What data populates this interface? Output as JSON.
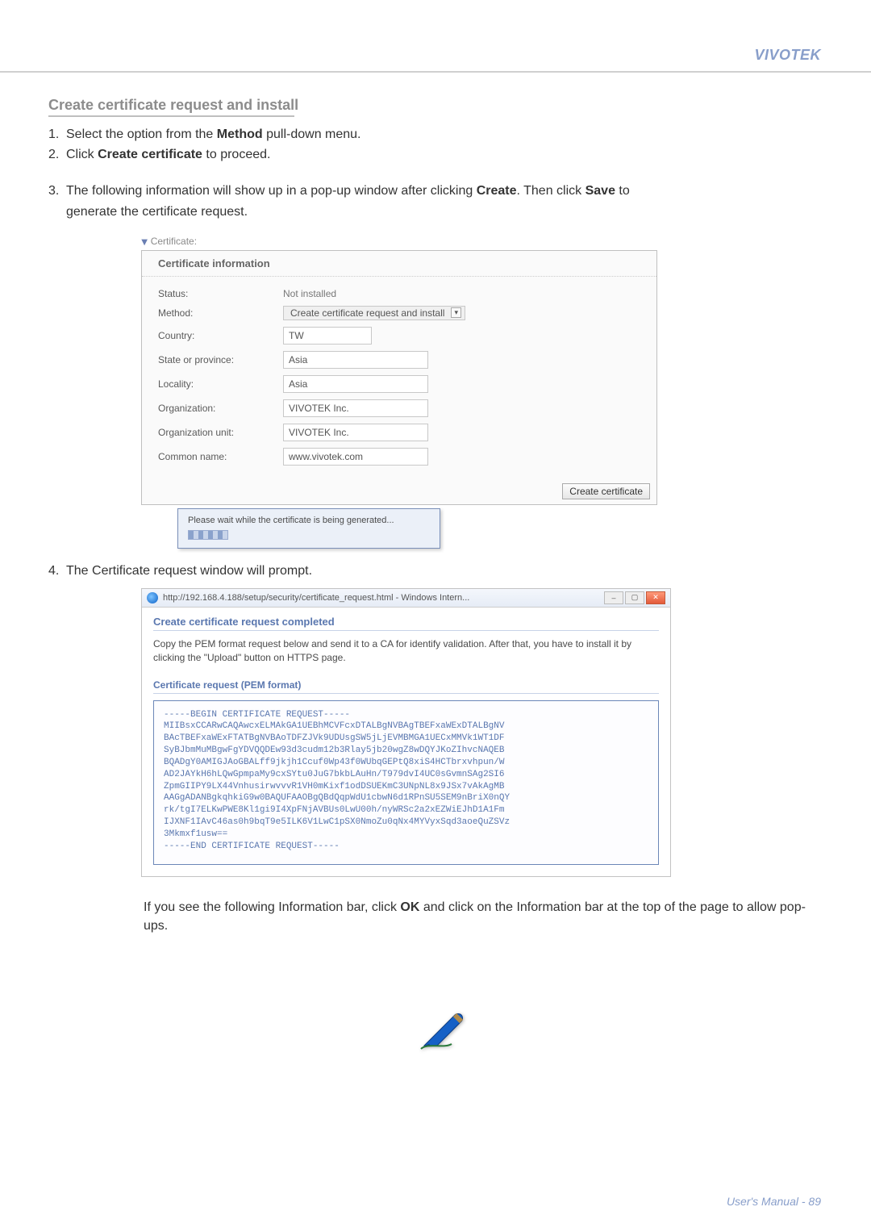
{
  "brand": "VIVOTEK",
  "section_title": "Create certificate request and install",
  "steps": {
    "s1": "Select the option from the ",
    "s1_bold": "Method",
    "s1_tail": " pull-down menu.",
    "s2_pre": "Click ",
    "s2_bold": "Create certificate",
    "s2_tail": " to proceed.",
    "s3_pre": "The following information will show up in a pop-up window after clicking ",
    "s3_bold": "Create",
    "s3_mid": ". Then click ",
    "s3_bold2": "Save",
    "s3_tail": " to ",
    "s3_line2": "generate the certificate request.",
    "s4": "The Certificate request window will prompt."
  },
  "cert": {
    "expand_label": "Certificate:",
    "header": "Certificate information",
    "rows": {
      "status_label": "Status:",
      "status_value": "Not installed",
      "method_label": "Method:",
      "method_value": "Create certificate request and install",
      "country_label": "Country:",
      "country_value": "TW",
      "state_label": "State or province:",
      "state_value": "Asia",
      "locality_label": "Locality:",
      "locality_value": "Asia",
      "org_label": "Organization:",
      "org_value": "VIVOTEK Inc.",
      "ou_label": "Organization unit:",
      "ou_value": "VIVOTEK Inc.",
      "cn_label": "Common name:",
      "cn_value": "www.vivotek.com"
    },
    "create_btn": "Create certificate"
  },
  "wait": {
    "msg": "Please wait while the certificate is being generated..."
  },
  "pem": {
    "url": "http://192.168.4.188/setup/security/certificate_request.html - Windows Intern...",
    "title": "Create certificate request completed",
    "desc": "Copy the PEM format request below and send it to a CA for identify validation. After that, you have to install it by clicking the \"Upload\" button on HTTPS page.",
    "sub": "Certificate request (PEM format)",
    "line_begin": "-----BEGIN CERTIFICATE REQUEST-----",
    "l1": "MIIBsxCCARwCAQAwcxELMAkGA1UEBhMCVFcxDTALBgNVBAgTBEFxaWExDTALBgNV",
    "l2": "BAcTBEFxaWExFTATBgNVBAoTDFZJVk9UDUsgSW5jLjEVMBMGA1UECxMMVk1WT1DF",
    "l3": "SyBJbmMuMBgwFgYDVQQDEw93d3cudm12b3Rlay5jb20wgZ8wDQYJKoZIhvcNAQEB",
    "l4": "BQADgY0AMIGJAoGBALff9jkjh1Ccuf0Wp43f0WUbqGEPtQ8xiS4HCTbrxvhpun/W",
    "l5": "AD2JAYkH6hLQwGpmpaMy9cxSYtu0JuG7bkbLAuHn/T979dvI4UC0sGvmnSAg2SI6",
    "l6": "ZpmGIIPY9LX44VnhusirwvvvR1VH0mKixf1odDSUEKmC3UNpNL8x9JSx7vAkAgMB",
    "l7": "AAGgADANBgkqhkiG9w0BAQUFAAOBgQBdQqpWdU1cbwN6d1RPnSU5SEM9nBriX0nQY",
    "l8": "rk/tgI7ELKwPWE8Kl1gi9I4XpFNjAVBUs0LwU00h/nyWRSc2a2xEZWiEJhD1A1Fm",
    "l9": "IJXNF1IAvC46as0h9bqT9e5ILK6V1LwC1pSX0NmoZu0qNx4MYVyxSqd3aoeQuZSVz",
    "l10": "3Mkmxf1usw==",
    "line_end": "-----END CERTIFICATE REQUEST-----"
  },
  "post": {
    "pre": "If you see the following Information bar, click ",
    "bold": "OK",
    "mid": " and click on the Information bar at the top of the page to allow pop-ups."
  },
  "footer": {
    "label": "User's Manual - ",
    "page": "89"
  }
}
